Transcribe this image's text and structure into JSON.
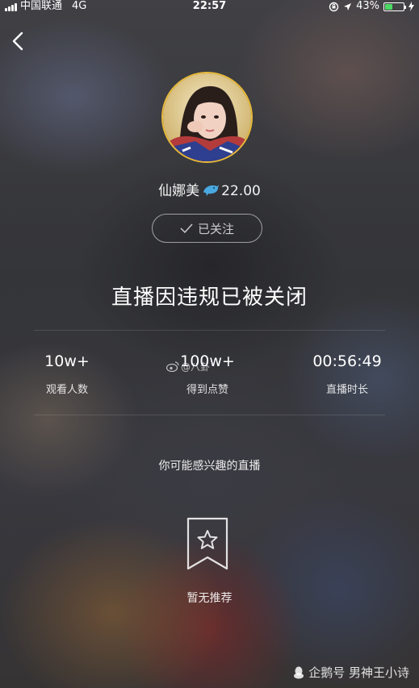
{
  "status_bar": {
    "carrier": "中国联通",
    "network": "4G",
    "time": "22:57",
    "battery": "43%",
    "battery_level": 0.43
  },
  "streamer": {
    "name": "仙娜美",
    "badge_icon": "dolphin-icon",
    "score": "22.00",
    "follow_label": "已关注"
  },
  "closed_title": "直播因违规已被关闭",
  "stats": [
    {
      "value": "10w+",
      "label": "观看人数"
    },
    {
      "value": "100w+",
      "label": "得到点赞"
    },
    {
      "value": "00:56:49",
      "label": "直播时长"
    }
  ],
  "weibo_watermark": "@八卦",
  "recommend": {
    "title": "你可能感兴趣的直播",
    "empty_text": "暂无推荐"
  },
  "footer_watermark": "企鹅号 男神王小诗",
  "colors": {
    "avatar_border": "#e6b83a",
    "battery_fill": "#4cd964"
  }
}
